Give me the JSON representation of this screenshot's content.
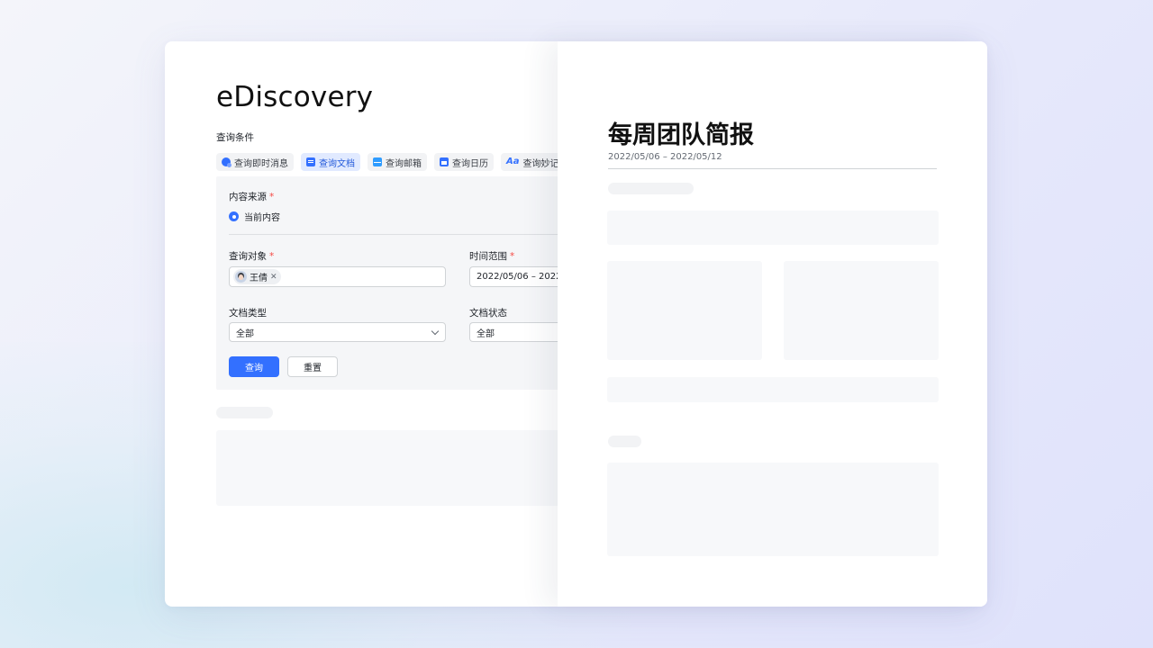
{
  "left": {
    "app_title": "eDiscovery",
    "section_label": "查询条件",
    "tabs": [
      {
        "label": "查询即时消息",
        "icon": "chat-icon",
        "active": false
      },
      {
        "label": "查询文档",
        "icon": "doc-icon",
        "active": true
      },
      {
        "label": "查询邮箱",
        "icon": "mail-icon",
        "active": false
      },
      {
        "label": "查询日历",
        "icon": "calendar-icon",
        "active": false
      },
      {
        "label": "查询妙记",
        "icon": "notes-icon",
        "active": false
      }
    ],
    "form": {
      "content_source_label": "内容来源",
      "required_mark": "*",
      "content_source_option": "当前内容",
      "target_label": "查询对象",
      "target_chip": "王倩",
      "time_range_label": "时间范围",
      "time_range_value": "2022/05/06 – 2022",
      "doc_type_label": "文档类型",
      "doc_type_value": "全部",
      "doc_status_label": "文档状态",
      "doc_status_value": "全部",
      "query_button": "查询",
      "reset_button": "重置"
    }
  },
  "report": {
    "title": "每周团队简报",
    "date_range": "2022/05/06 – 2022/05/12"
  },
  "colors": {
    "accent": "#3370ff",
    "required": "#f54a45",
    "active_tab_bg": "#e1eaff"
  }
}
